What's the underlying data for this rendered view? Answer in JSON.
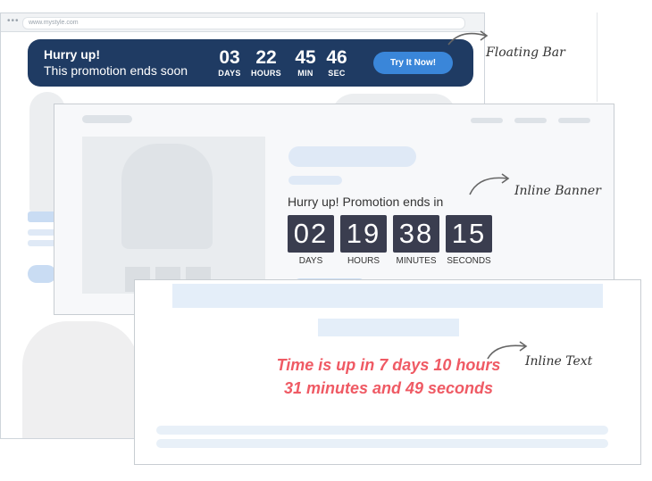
{
  "browser": {
    "address_url": "www.mystyle.com",
    "dots": "•••"
  },
  "floating_bar": {
    "title": "Hurry up!",
    "subtitle": "This promotion ends soon",
    "countdown": [
      {
        "value": "03",
        "label": "DAYS"
      },
      {
        "value": "22",
        "label": "HOURS"
      },
      {
        "value": "45",
        "label": "MIN"
      },
      {
        "value": "46",
        "label": "SEC"
      }
    ],
    "cta_label": "Try It Now!",
    "background_color": "#1f3b63",
    "cta_color": "#3a86d9"
  },
  "inline_banner": {
    "heading": "Hurry up! Promotion ends in",
    "countdown": [
      {
        "value": "02",
        "label": "DAYS"
      },
      {
        "value": "19",
        "label": "HOURS"
      },
      {
        "value": "38",
        "label": "MINUTES"
      },
      {
        "value": "15",
        "label": "SECONDS"
      }
    ],
    "box_color": "#3a3d4f"
  },
  "inline_text": {
    "line1": "Time is up in 7 days 10 hours",
    "line2": "31 minutes and 49 seconds",
    "color": "#ef5a64"
  },
  "callouts": {
    "floating_bar": "Floating Bar",
    "inline_banner": "Inline Banner",
    "inline_text": "Inline Text"
  }
}
